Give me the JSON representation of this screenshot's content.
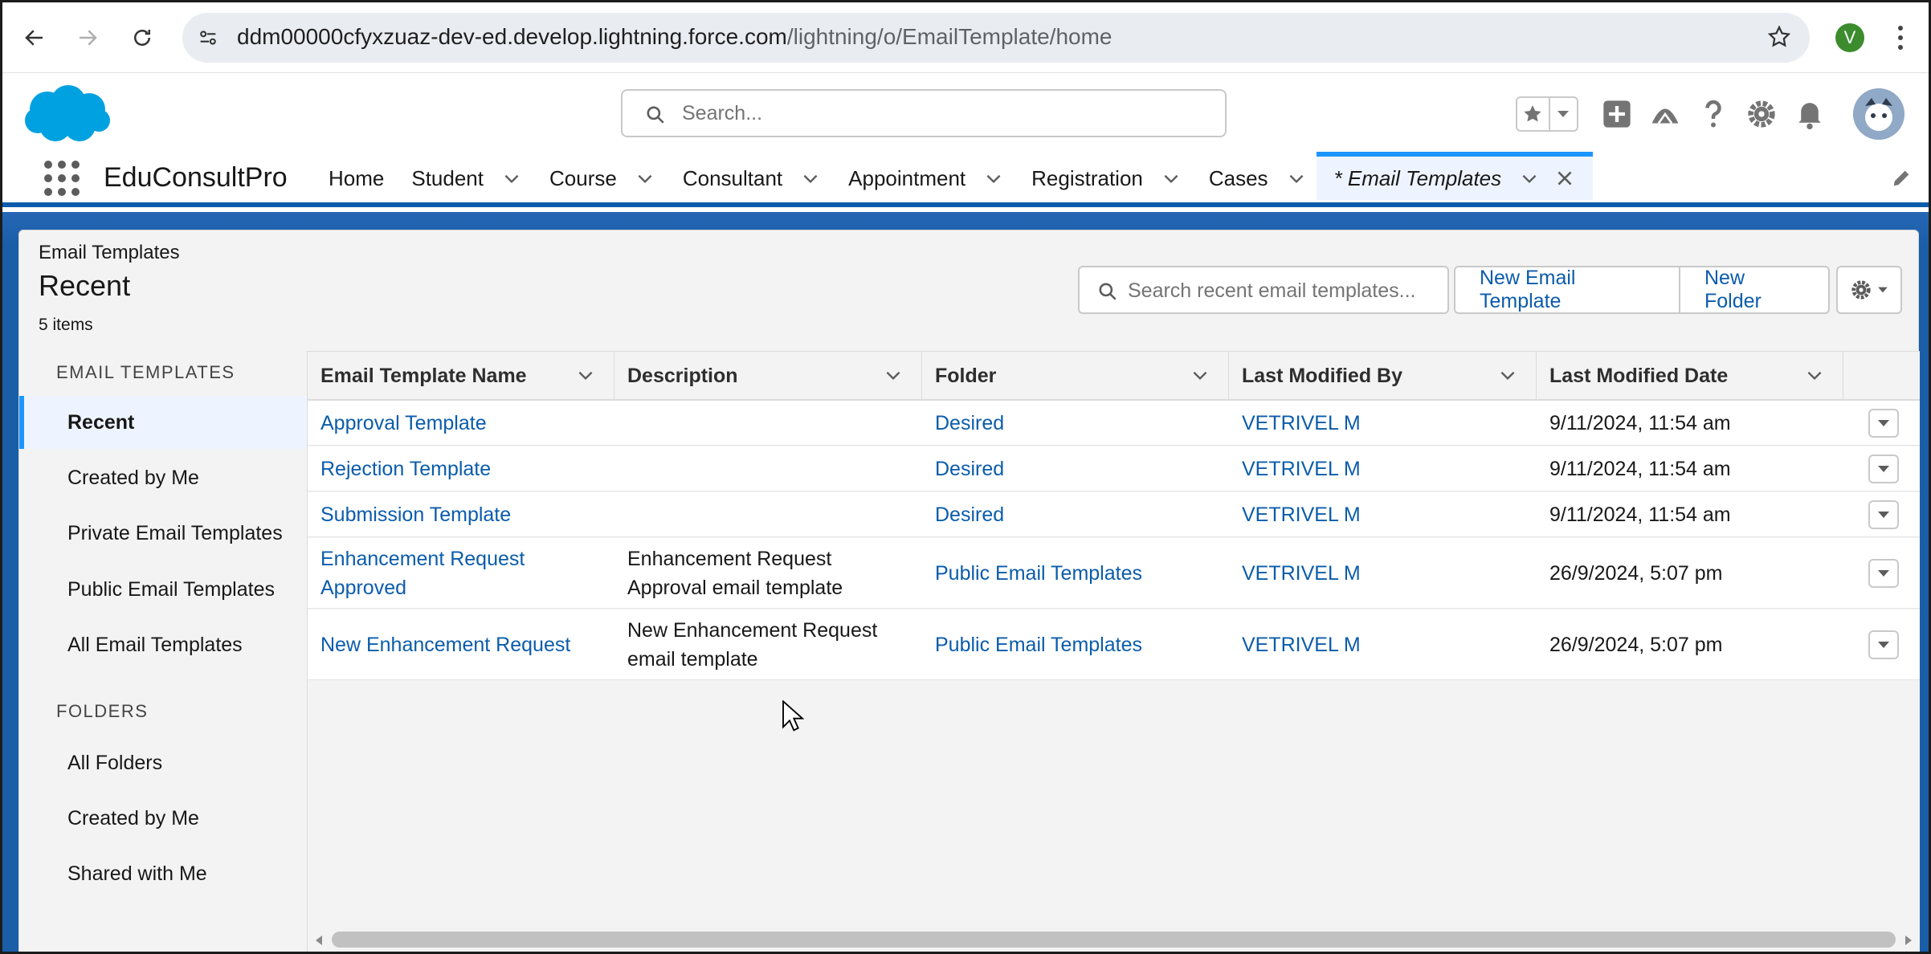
{
  "browser": {
    "url_host": "ddm00000cfyxzuaz-dev-ed.develop.lightning.force.com",
    "url_path": "/lightning/o/EmailTemplate/home",
    "profile_initial": "V"
  },
  "header": {
    "search_placeholder": "Search..."
  },
  "app": {
    "name": "EduConsultPro",
    "nav": [
      {
        "label": "Home"
      },
      {
        "label": "Student"
      },
      {
        "label": "Course"
      },
      {
        "label": "Consultant"
      },
      {
        "label": "Appointment"
      },
      {
        "label": "Registration"
      },
      {
        "label": "Cases"
      }
    ],
    "active_tab": "* Email Templates"
  },
  "list": {
    "breadcrumb": "Email Templates",
    "title": "Recent",
    "count": "5 items",
    "search_placeholder": "Search recent email templates...",
    "new_template_label": "New Email Template",
    "new_folder_label": "New Folder"
  },
  "sidebar": {
    "templates_heading": "EMAIL TEMPLATES",
    "template_items": [
      "Recent",
      "Created by Me",
      "Private Email Templates",
      "Public Email Templates",
      "All Email Templates"
    ],
    "folders_heading": "FOLDERS",
    "folder_items": [
      "All Folders",
      "Created by Me",
      "Shared with Me"
    ]
  },
  "table": {
    "columns": [
      "Email Template Name",
      "Description",
      "Folder",
      "Last Modified By",
      "Last Modified Date"
    ],
    "rows": [
      {
        "name": "Approval Template",
        "description": "",
        "folder": "Desired",
        "modified_by": "VETRIVEL M",
        "modified_date": "9/11/2024, 11:54 am"
      },
      {
        "name": "Rejection Template",
        "description": "",
        "folder": "Desired",
        "modified_by": "VETRIVEL M",
        "modified_date": "9/11/2024, 11:54 am"
      },
      {
        "name": "Submission Template",
        "description": "",
        "folder": "Desired",
        "modified_by": "VETRIVEL M",
        "modified_date": "9/11/2024, 11:54 am"
      },
      {
        "name": "Enhancement Request Approved",
        "description": "Enhancement Request Approval email template",
        "folder": "Public Email Templates",
        "modified_by": "VETRIVEL M",
        "modified_date": "26/9/2024, 5:07 pm"
      },
      {
        "name": "New Enhancement Request",
        "description": "New Enhancement Request email template",
        "folder": "Public Email Templates",
        "modified_by": "VETRIVEL M",
        "modified_date": "26/9/2024, 5:07 pm"
      }
    ]
  },
  "colors": {
    "brand_blue": "#0b5cab",
    "active_tab_bg": "#eef4ff",
    "accent": "#1b96ff"
  }
}
